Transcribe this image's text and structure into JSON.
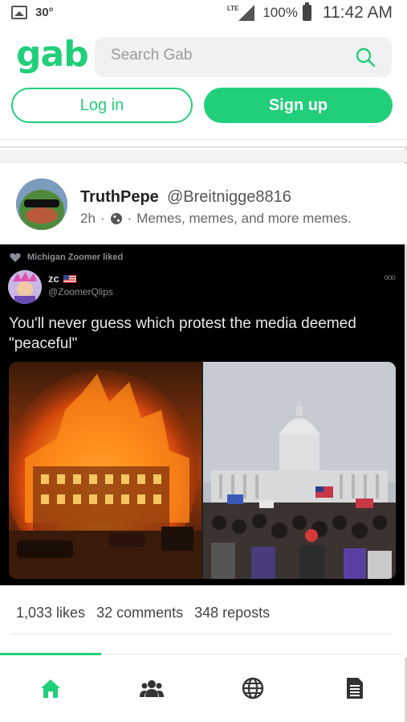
{
  "status_bar": {
    "temperature": "30°",
    "network": "LTE",
    "battery": "100%",
    "time": "11:42 AM"
  },
  "header": {
    "logo": "gab",
    "search_placeholder": "Search Gab",
    "login_label": "Log in",
    "signup_label": "Sign up"
  },
  "post": {
    "author_name": "TruthPepe",
    "author_handle": "@Breitnigge8816",
    "time": "2h",
    "separator": "·",
    "group": "Memes, memes, and more memes.",
    "embed": {
      "liked_by": "Michigan Zoomer liked",
      "name": "zc",
      "handle": "@ZoomerQlips",
      "more": "ooo",
      "text": "You'll never guess which protest the media deemed \"peaceful\""
    },
    "stats": {
      "likes": "1,033 likes",
      "comments": "32 comments",
      "reposts": "348 reposts"
    }
  },
  "nav": {
    "items": [
      "home-icon",
      "groups-icon",
      "explore-globe-icon",
      "news-icon"
    ],
    "active": "home-icon"
  },
  "colors": {
    "brand": "#21cf7a",
    "nav_inactive": "#333333"
  }
}
